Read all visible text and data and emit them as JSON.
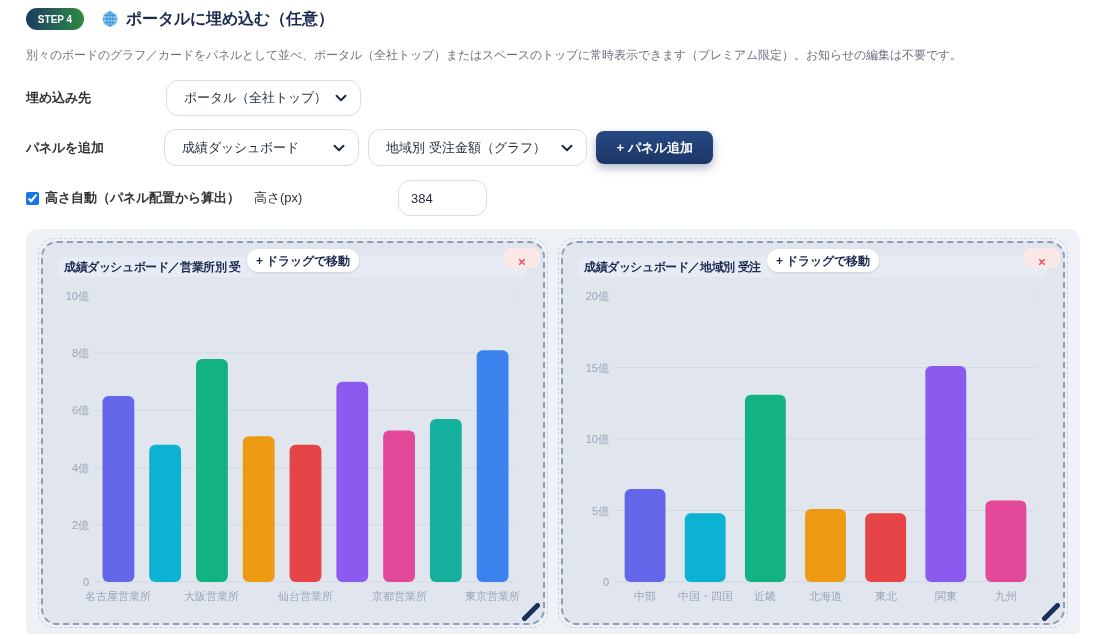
{
  "step_badge": "STEP 4",
  "title": "ポータルに埋め込む（任意）",
  "description": "別々のボードのグラフ／カードをパネルとして並べ、ポータル（全社トップ）またはスペースのトップに常時表示できます（プレミアム限定）。お知らせの編集は不要です。",
  "embed_target": {
    "label": "埋め込み先",
    "value": "ポータル（全社トップ）"
  },
  "add_panel": {
    "label": "パネルを追加",
    "board_value": "成績ダッシュボード",
    "chart_value": "地域別 受注金額（グラフ）",
    "button": "+ パネル追加"
  },
  "height": {
    "auto_label": "高さ自動（パネル配置から算出）",
    "auto_checked": true,
    "label": "高さ(px)",
    "value": "384"
  },
  "panels": [
    {
      "title": "成績ダッシュボード／営業所別 受",
      "drag_hint": "+ ドラッグで移動",
      "chart_data": {
        "type": "bar",
        "categories": [
          "名古屋営業所",
          null,
          "大阪営業所",
          null,
          "仙台営業所",
          null,
          "京都営業所",
          null,
          "東京営業所"
        ],
        "values": [
          6.5,
          4.8,
          7.8,
          5.1,
          4.8,
          7.0,
          5.3,
          5.7,
          8.1
        ],
        "colors": [
          "#6366e9",
          "#0bb2d1",
          "#12b381",
          "#eb9a12",
          "#e54546",
          "#8b5bf0",
          "#e44898",
          "#16b09f",
          "#3b82ee"
        ],
        "grid": true,
        "ylim": [
          0,
          10
        ],
        "yticks": [
          {
            "value": 0,
            "label": "0"
          },
          {
            "value": 2,
            "label": "2億"
          },
          {
            "value": 4,
            "label": "4億"
          },
          {
            "value": 6,
            "label": "6億"
          },
          {
            "value": 8,
            "label": "8億"
          },
          {
            "value": 10,
            "label": "10億"
          }
        ]
      }
    },
    {
      "title": "成績ダッシュボード／地域別 受注",
      "drag_hint": "+ ドラッグで移動",
      "chart_data": {
        "type": "bar",
        "categories": [
          "中部",
          "中国・四国",
          "近畿",
          "北海道",
          "東北",
          "関東",
          "九州"
        ],
        "values": [
          6.5,
          4.8,
          13.1,
          5.1,
          4.8,
          15.1,
          5.7
        ],
        "colors": [
          "#6366e9",
          "#0bb2d1",
          "#12b381",
          "#eb9a12",
          "#e54546",
          "#8b5bf0",
          "#e44898"
        ],
        "grid": true,
        "ylim": [
          0,
          20
        ],
        "yticks": [
          {
            "value": 0,
            "label": "0"
          },
          {
            "value": 5,
            "label": "5億"
          },
          {
            "value": 10,
            "label": "10億"
          },
          {
            "value": 15,
            "label": "15億"
          },
          {
            "value": 20,
            "label": "20億"
          }
        ]
      }
    }
  ]
}
